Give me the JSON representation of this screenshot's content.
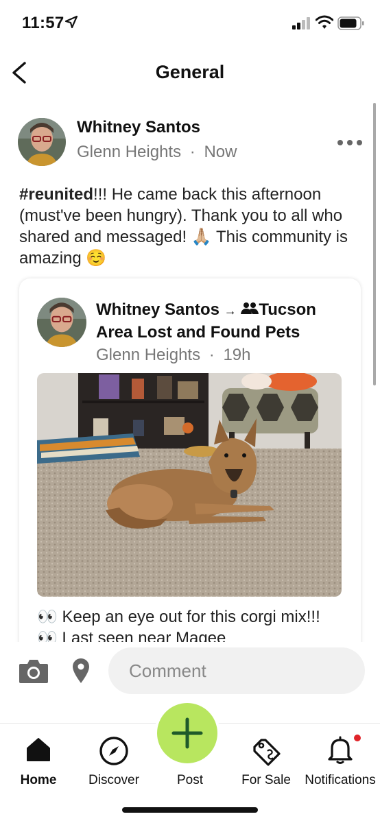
{
  "status_bar": {
    "time": "11:57"
  },
  "header": {
    "title": "General"
  },
  "post": {
    "author": "Whitney Santos",
    "location": "Glenn Heights",
    "separator": "·",
    "time": "Now",
    "body_hashtag": "#reunited",
    "body_text": "!!! He came back this afternoon (must've been hungry). Thank you to all who shared and messaged! 🙏🏼 This community is amazing ☺️"
  },
  "shared": {
    "author": "Whitney Santos",
    "arrow": "→",
    "group": "Tucson Area Lost and Found Pets",
    "location": "Glenn Heights",
    "separator": "·",
    "time": "19h",
    "text": "👀 Keep an eye out for this corgi mix!!! 👀 Last seen near Magee"
  },
  "comment": {
    "placeholder": "Comment"
  },
  "tabs": [
    {
      "label": "Home",
      "icon": "home-icon"
    },
    {
      "label": "Discover",
      "icon": "compass-icon"
    },
    {
      "label": "Post",
      "icon": "plus-icon"
    },
    {
      "label": "For Sale",
      "icon": "price-tag-icon"
    },
    {
      "label": "Notifications",
      "icon": "bell-icon"
    }
  ],
  "colors": {
    "post_button": "#b8e65f",
    "notification_dot": "#e0242a",
    "meta_text": "#777777"
  }
}
